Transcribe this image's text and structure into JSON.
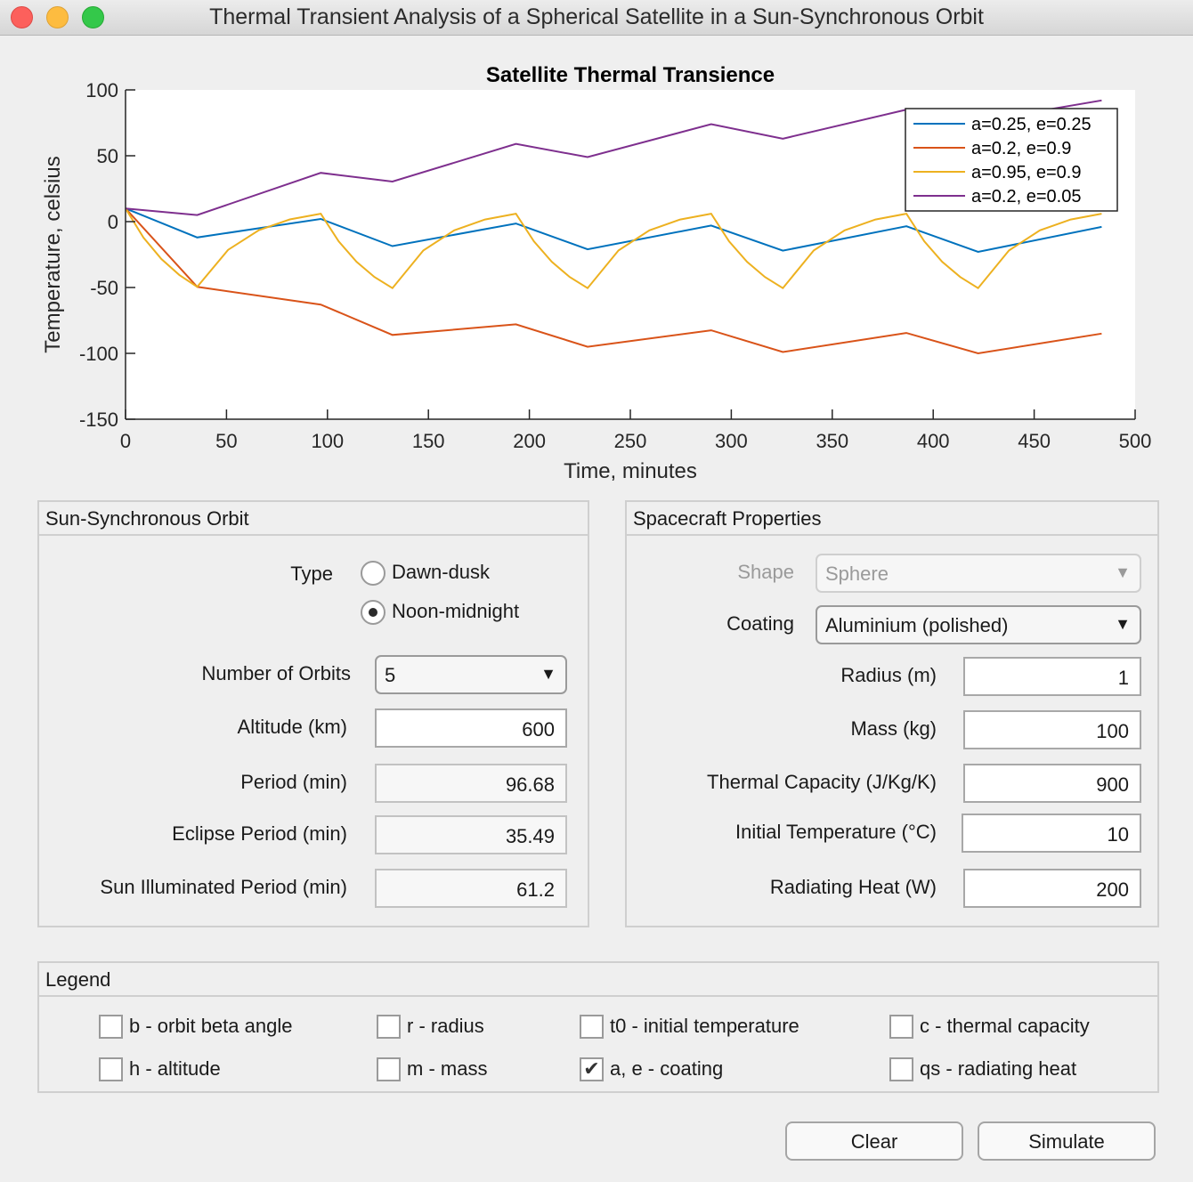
{
  "window": {
    "title": "Thermal Transient Analysis of a Spherical Satellite in a Sun-Synchronous Orbit"
  },
  "chart_data": {
    "type": "line",
    "title": "Satellite Thermal Transience",
    "xlabel": "Time, minutes",
    "ylabel": "Temperature, celsius",
    "xlim": [
      0,
      500
    ],
    "ylim": [
      -150,
      100
    ],
    "xticks": [
      0,
      50,
      100,
      150,
      200,
      250,
      300,
      350,
      400,
      450,
      500
    ],
    "yticks": [
      100,
      50,
      0,
      -50,
      -100,
      -150
    ],
    "grid": false,
    "legend_position": "top-right",
    "series": [
      {
        "name": "a=0.25, e=0.25",
        "color": "#0072bd",
        "x": [
          0,
          35.49,
          96.68,
          132.17,
          193.36,
          228.85,
          290.04,
          325.53,
          386.72,
          422.21,
          483.4
        ],
        "y": [
          10,
          -12,
          2,
          -18.6,
          -1.4,
          -21,
          -3,
          -22,
          -3.5,
          -23,
          -4
        ]
      },
      {
        "name": "a=0.2, e=0.9",
        "color": "#d95319",
        "x": [
          0,
          35.49,
          96.68,
          132.17,
          193.36,
          228.85,
          290.04,
          325.53,
          386.72,
          422.21,
          483.4
        ],
        "y": [
          10,
          -49.5,
          -63,
          -86,
          -78,
          -95,
          -82.5,
          -99,
          -84.5,
          -100,
          -85
        ]
      },
      {
        "name": "a=0.95, e=0.9",
        "color": "#edb120",
        "x": [
          0,
          8.87,
          17.75,
          26.62,
          35.49,
          50.79,
          66.09,
          81.38,
          96.68,
          105.55,
          114.43,
          123.3,
          132.17,
          147.47,
          162.77,
          178.06,
          193.36,
          202.23,
          211.11,
          219.98,
          228.85,
          244.15,
          259.45,
          274.74,
          290.04,
          298.91,
          307.79,
          316.66,
          325.53,
          340.83,
          356.13,
          371.42,
          386.72,
          395.59,
          404.47,
          413.34,
          422.21,
          437.51,
          452.81,
          468.1,
          483.4
        ],
        "y": [
          10,
          -12.1,
          -28.4,
          -40.5,
          -49.5,
          -21.4,
          -6.4,
          1.7,
          6,
          -15,
          -30.5,
          -42,
          -50.5,
          -21.9,
          -6.6,
          1.6,
          6,
          -15,
          -30.5,
          -42,
          -50.5,
          -21.9,
          -6.6,
          1.6,
          6,
          -15,
          -30.5,
          -42,
          -50.5,
          -21.9,
          -6.6,
          1.6,
          6,
          -15,
          -30.5,
          -42,
          -50.5,
          -21.9,
          -6.6,
          1.6,
          6
        ]
      },
      {
        "name": "a=0.2, e=0.05",
        "color": "#7e2f8e",
        "x": [
          0,
          35.49,
          96.68,
          132.17,
          193.36,
          228.85,
          290.04,
          325.53,
          386.72,
          422.21,
          483.4
        ],
        "y": [
          10,
          5,
          37,
          30.4,
          59,
          49,
          74,
          63,
          85,
          76,
          92
        ]
      }
    ]
  },
  "orbit_panel": {
    "title": "Sun-Synchronous Orbit",
    "type_label": "Type",
    "type_options": [
      {
        "label": "Dawn-dusk",
        "selected": false
      },
      {
        "label": "Noon-midnight",
        "selected": true
      }
    ],
    "num_orbits_label": "Number of Orbits",
    "num_orbits_value": "5",
    "altitude_label": "Altitude (km)",
    "altitude_value": "600",
    "period_label": "Period (min)",
    "period_value": "96.68",
    "eclipse_label": "Eclipse Period (min)",
    "eclipse_value": "35.49",
    "sun_label": "Sun Illuminated Period (min)",
    "sun_value": "61.2"
  },
  "spacecraft_panel": {
    "title": "Spacecraft Properties",
    "shape_label": "Shape",
    "shape_value": "Sphere",
    "coating_label": "Coating",
    "coating_value": "Aluminium (polished)",
    "radius_label": "Radius (m)",
    "radius_value": "1",
    "mass_label": "Mass (kg)",
    "mass_value": "100",
    "capacity_label": "Thermal Capacity (J/Kg/K)",
    "capacity_value": "900",
    "init_temp_label": "Initial Temperature (°C)",
    "init_temp_value": "10",
    "heat_label": "Radiating Heat (W)",
    "heat_value": "200"
  },
  "legend_panel": {
    "title": "Legend",
    "items": [
      {
        "label": "b - orbit beta angle",
        "checked": false
      },
      {
        "label": "r - radius",
        "checked": false
      },
      {
        "label": "t0 - initial temperature",
        "checked": false
      },
      {
        "label": "c - thermal capacity",
        "checked": false
      },
      {
        "label": "h - altitude",
        "checked": false
      },
      {
        "label": "m - mass",
        "checked": false
      },
      {
        "label": "a, e - coating",
        "checked": true
      },
      {
        "label": "qs - radiating heat",
        "checked": false
      }
    ]
  },
  "buttons": {
    "clear": "Clear",
    "simulate": "Simulate"
  }
}
